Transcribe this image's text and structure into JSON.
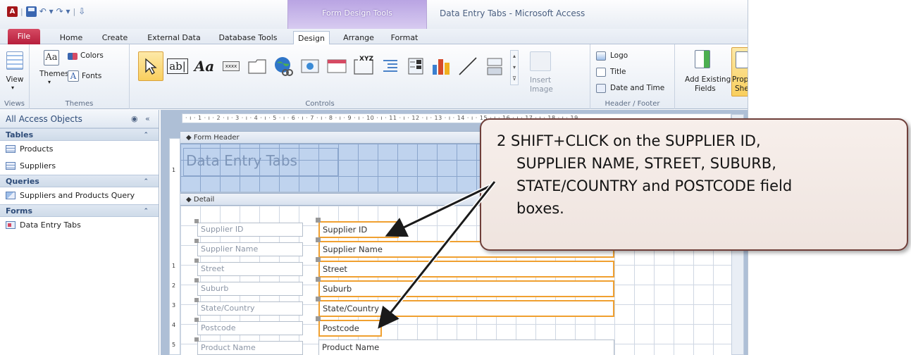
{
  "window": {
    "title": "Data Entry Tabs - Microsoft Access",
    "contextual_tab_group": "Form Design Tools"
  },
  "tabs": [
    "File",
    "Home",
    "Create",
    "External Data",
    "Database Tools",
    "Design",
    "Arrange",
    "Format"
  ],
  "active_tab": "Design",
  "ribbon": {
    "views": {
      "button": "View",
      "group": "Views"
    },
    "themes": {
      "themes": "Themes",
      "colors": "Colors",
      "fonts": "Fonts",
      "group": "Themes"
    },
    "controls": {
      "group": "Controls",
      "text_box": "ab|",
      "label": "Aa",
      "button_glyph": "xxxx",
      "tab_xyz": "XYZ"
    },
    "header_footer": {
      "insert_image_line1": "Insert",
      "insert_image_line2": "Image",
      "logo": "Logo",
      "title": "Title",
      "date_time": "Date and Time",
      "group": "Header / Footer"
    },
    "tools": {
      "add_existing_1": "Add Existing",
      "add_existing_2": "Fields",
      "property_sheet_1": "Prope",
      "property_sheet_2": "She"
    }
  },
  "nav": {
    "header": "All Access Objects",
    "sections": [
      {
        "name": "Tables",
        "items": [
          "Products",
          "Suppliers"
        ]
      },
      {
        "name": "Queries",
        "items": [
          "Suppliers and Products Query"
        ]
      },
      {
        "name": "Forms",
        "items": [
          "Data Entry Tabs"
        ]
      }
    ]
  },
  "design": {
    "ruler": "· ı · 1 · ı · 2 · ı · 3 · ı · 4 · ı · 5 · ı · 6 · ı · 7 · ı · 8 · ı · 9 · ı · 10 · ı · 11 · ı · 12 · ı · 13 · ı · 14 · ı · 15 · ı · 16 · ı · 17 · ı · 18 · ı · 19",
    "form_header": "Form Header",
    "title_label": "Data Entry Tabs",
    "detail": "Detail",
    "fields": [
      {
        "label": "Supplier ID",
        "box": "Supplier ID"
      },
      {
        "label": "Supplier Name",
        "box": "Supplier Name"
      },
      {
        "label": "Street",
        "box": "Street"
      },
      {
        "label": "Suburb",
        "box": "Suburb"
      },
      {
        "label": "State/Country",
        "box": "State/Country"
      },
      {
        "label": "Postcode",
        "box": "Postcode"
      },
      {
        "label": "Product Name",
        "box": "Product Name"
      }
    ]
  },
  "callout": {
    "line1": "2  SHIFT+CLICK on the SUPPLIER ID,",
    "line2": "SUPPLIER NAME, STREET, SUBURB,",
    "line3": "STATE/COUNTRY and POSTCODE field",
    "line4": "boxes."
  }
}
